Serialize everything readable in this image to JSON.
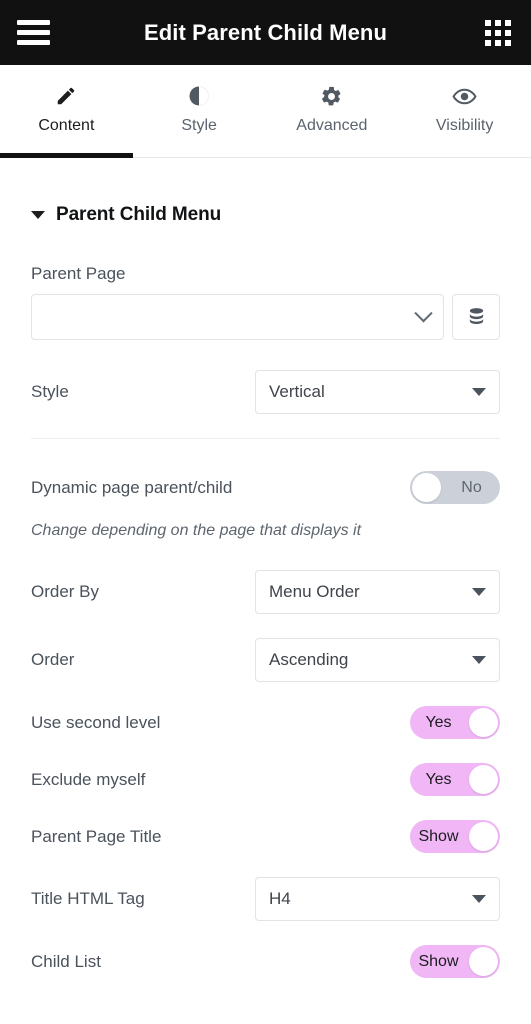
{
  "topbar": {
    "title": "Edit Parent Child Menu",
    "menu_icon": "hamburger-icon",
    "apps_icon": "grid-apps-icon"
  },
  "tabs": [
    {
      "label": "Content",
      "icon": "pencil-icon",
      "active": true
    },
    {
      "label": "Style",
      "icon": "contrast-icon",
      "active": false
    },
    {
      "label": "Advanced",
      "icon": "gear-icon",
      "active": false
    },
    {
      "label": "Visibility",
      "icon": "eye-icon",
      "active": false
    }
  ],
  "section": {
    "title": "Parent Child Menu",
    "collapse_icon": "caret-down-icon",
    "expanded": true
  },
  "fields": {
    "parent_page": {
      "label": "Parent Page",
      "value": "",
      "placeholder": "",
      "dynamic_icon": "database-icon"
    },
    "style": {
      "label": "Style",
      "value": "Vertical"
    },
    "dynamic_page": {
      "label": "Dynamic page parent/child",
      "value": "No",
      "state": "off",
      "helper": "Change depending on the page that displays it"
    },
    "order_by": {
      "label": "Order By",
      "value": "Menu Order"
    },
    "order": {
      "label": "Order",
      "value": "Ascending"
    },
    "use_second_level": {
      "label": "Use second level",
      "value": "Yes",
      "state": "on"
    },
    "exclude_myself": {
      "label": "Exclude myself",
      "value": "Yes",
      "state": "on"
    },
    "parent_page_title": {
      "label": "Parent Page Title",
      "value": "Show",
      "state": "on"
    },
    "title_html_tag": {
      "label": "Title HTML Tag",
      "value": "H4"
    },
    "child_list": {
      "label": "Child List",
      "value": "Show",
      "state": "on"
    }
  },
  "colors": {
    "topbar_bg": "#111111",
    "toggle_on": "#f0b6f6",
    "toggle_off": "#ccd1d9",
    "text": "#4a525b",
    "border": "#e0e3e7"
  }
}
